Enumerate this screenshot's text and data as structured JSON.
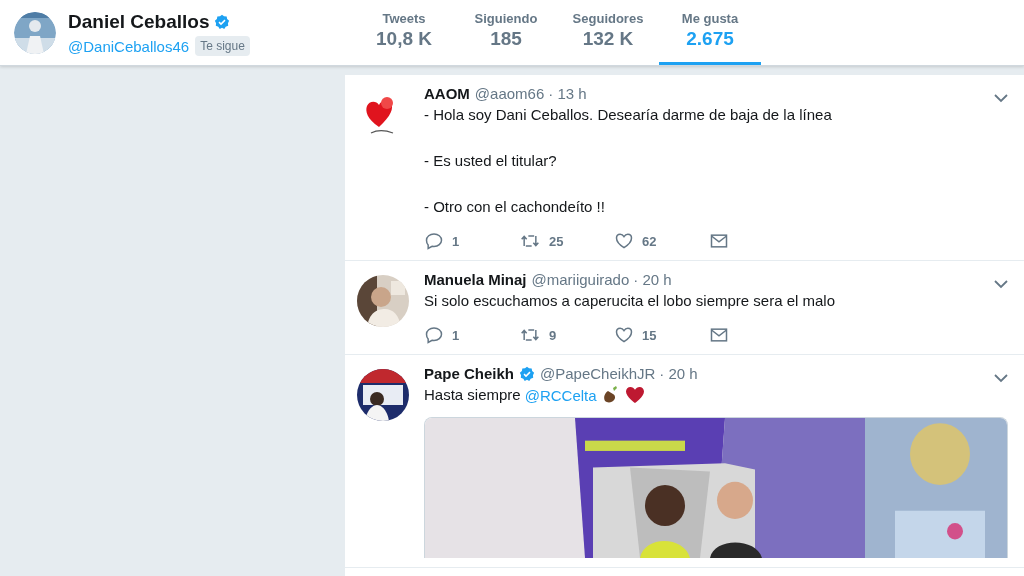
{
  "profile": {
    "name": "Daniel Ceballos",
    "verified": true,
    "handle": "@DaniCeballos46",
    "follows_you": "Te sigue"
  },
  "stats": [
    {
      "label": "Tweets",
      "value": "10,8 K",
      "selected": false
    },
    {
      "label": "Siguiendo",
      "value": "185",
      "selected": false
    },
    {
      "label": "Seguidores",
      "value": "132 K",
      "selected": false
    },
    {
      "label": "Me gusta",
      "value": "2.675",
      "selected": true
    }
  ],
  "tweets": [
    {
      "name": "AAOM",
      "handle": "@aaom66",
      "time": "· 13 h",
      "paragraphs": [
        "- Hola soy Dani Ceballos. Desearía darme de baja de la línea",
        "- Es usted el titular?",
        "- Otro con el cachondeíto !!"
      ],
      "replies": "1",
      "retweets": "25",
      "likes": "62"
    },
    {
      "name": "Manuela Minaj",
      "handle": "@mariiguirado",
      "time": "· 20 h",
      "paragraphs": [
        "Si solo escuchamos a caperucita el lobo siempre sera el malo"
      ],
      "replies": "1",
      "retweets": "9",
      "likes": "15"
    },
    {
      "name": "Pape Cheikh",
      "verified": true,
      "handle": "@PapeCheikhJR",
      "time": "· 20 h",
      "paragraphs": [
        "Hasta siempre"
      ],
      "link": "@RCCelta",
      "emoji": true,
      "media": true
    }
  ]
}
